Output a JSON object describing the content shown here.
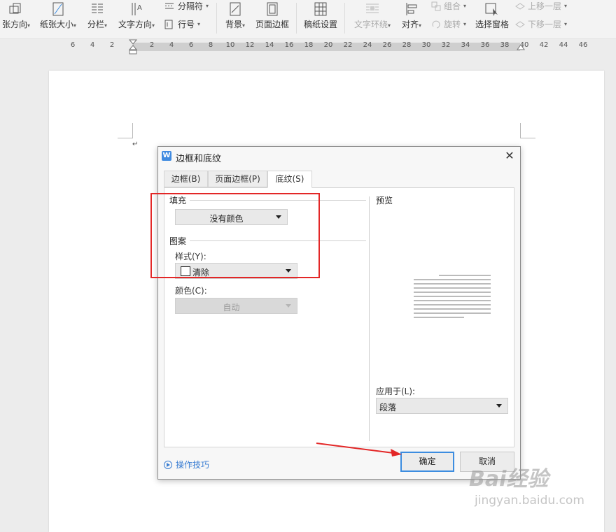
{
  "ribbon": {
    "items": [
      {
        "label": "张方向",
        "caret": true
      },
      {
        "label": "纸张大小",
        "caret": true
      },
      {
        "label": "分栏",
        "caret": true
      },
      {
        "label": "文字方向",
        "caret": true
      },
      {
        "label": "分隔符",
        "caret": true
      },
      {
        "label": "行号",
        "caret": true
      },
      {
        "label": "背景",
        "caret": true
      },
      {
        "label": "页面边框",
        "caret": false
      },
      {
        "label": "稿纸设置",
        "caret": false
      },
      {
        "label": "文字环绕",
        "caret": true
      },
      {
        "label": "对齐",
        "caret": true
      },
      {
        "label": "组合",
        "caret": true
      },
      {
        "label": "旋转",
        "caret": true
      },
      {
        "label": "选择窗格",
        "caret": false
      },
      {
        "label": "上移一层",
        "caret": true
      },
      {
        "label": "下移一层",
        "caret": true
      }
    ]
  },
  "ruler": {
    "left_ticks": [
      "6",
      "4",
      "2"
    ],
    "right_ticks": [
      "2",
      "4",
      "6",
      "8",
      "10",
      "12",
      "14",
      "16",
      "18",
      "20",
      "22",
      "24",
      "26",
      "28",
      "30",
      "32",
      "34",
      "36",
      "38",
      "40",
      "42",
      "44",
      "46"
    ]
  },
  "document": {
    "para_mark": "↵"
  },
  "dialog": {
    "title": "边框和底纹",
    "close": "✕",
    "tabs": [
      {
        "label": "边框(B)",
        "active": false
      },
      {
        "label": "页面边框(P)",
        "active": false
      },
      {
        "label": "底纹(S)",
        "active": true
      }
    ],
    "fill": {
      "section_label": "填充",
      "color_value": "没有颜色"
    },
    "pattern": {
      "section_label": "图案",
      "style_label": "样式(Y):",
      "style_value": "清除",
      "color_label": "颜色(C):",
      "color_value": "自动"
    },
    "preview": {
      "label": "预览"
    },
    "apply_to": {
      "label": "应用于(L):",
      "value": "段落"
    },
    "tips_link": "操作技巧",
    "ok_label": "确定",
    "cancel_label": "取消"
  },
  "watermark": {
    "brand": "Bai经验",
    "url": "jingyan.baidu.com"
  },
  "colors": {
    "accent": "#3d8de0",
    "annotation": "#e32727"
  }
}
